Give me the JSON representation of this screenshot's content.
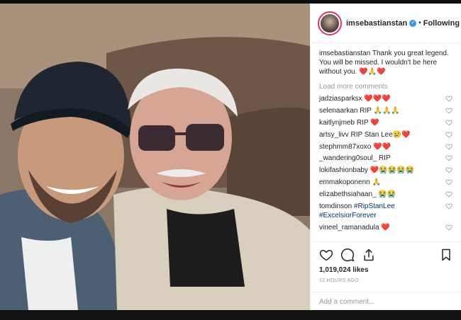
{
  "post": {
    "username": "imsebastianstan",
    "verified_icon": "verified-badge-icon",
    "separator": "•",
    "follow_status": "Following"
  },
  "caption": {
    "username": "imsebastianstan",
    "text": "Thank you great legend. You will be missed. I wouldn't be here without you. ❤️🙏❤️"
  },
  "load_more": "Load more comments",
  "comments": [
    {
      "user": "jadziasparksx",
      "text": "❤️❤️❤️"
    },
    {
      "user": "selenaarkan",
      "text": "RIP 🙏🙏🙏"
    },
    {
      "user": "kaitlynjmeb",
      "text": "RIP ❤️"
    },
    {
      "user": "artsy_livv",
      "text": "RIP Stan Lee😢❤️"
    },
    {
      "user": "stephmm87xoxo",
      "text": "❤️❤️"
    },
    {
      "user": "_wandering0soul_",
      "text": "RIP"
    },
    {
      "user": "lokifashionbaby",
      "text": "❤️😭😭😭😭"
    },
    {
      "user": "emmakoponenn",
      "text": "🙏"
    },
    {
      "user": "elizabethsiahaan_",
      "text": "😭😭"
    },
    {
      "user": "tomdinson",
      "text": "#RipStanLee #ExcelsiorForever"
    },
    {
      "user": "vineel_ramanadula",
      "text": "❤️"
    }
  ],
  "likes": "1,019,024 likes",
  "time_ago": "12 HOURS AGO",
  "add_comment_placeholder": "Add a comment...",
  "colors": {
    "heart": "#ed4956",
    "link": "#003569",
    "verified": "#3897f0"
  }
}
